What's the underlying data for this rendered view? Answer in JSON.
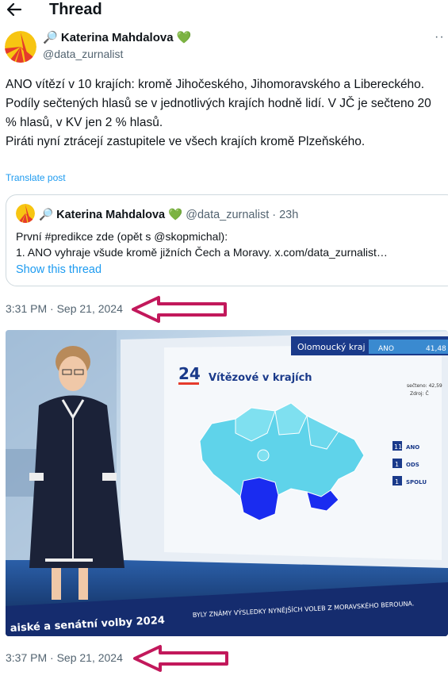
{
  "header": {
    "title": "Thread",
    "back_icon": "arrow-left-icon"
  },
  "post": {
    "author_emoji": "🔎",
    "author_name": "Katerina Mahdalova",
    "author_badge": "💚",
    "handle": "@data_zurnalist",
    "more_label": "··",
    "text": "ANO vítězí v 10 krajích: kromě Jihočeského, Jihomoravského a Libereckého.\nPodíly sečtených hlasů se v jednotlivých krajích hodně lidí. V JČ je sečteno 20 % hlasů, v KV jen 2 % hlasů.\nPiráti nyní ztrácejí zastupitele ve všech krajích kromě Plzeňského.",
    "translate_label": "Translate post",
    "timestamp_1": "3:31 PM · Sep 21, 2024",
    "timestamp_2": "3:37 PM · Sep 21, 2024"
  },
  "quote": {
    "author_emoji": "🔎",
    "author_name": "Katerina Mahdalova",
    "author_badge": "💚",
    "handle": "@data_zurnalist",
    "age": "· 23h",
    "text": "První #predikce zde (opět s @skopmichal):\n1. ANO vyhraje všude kromě jižních Čech a Moravy. x.com/data_zurnalist…",
    "show_thread_label": "Show this thread"
  },
  "tv": {
    "region_label": "Olomoucký kraj",
    "region_party": "ANO",
    "region_value": "41,48",
    "logo": "24",
    "map_title": "Vítězové v krajích",
    "counted_label": "sečteno: 42,59",
    "source_label": "Zdroj: Č",
    "legend": [
      {
        "count": "11",
        "party": "ANO",
        "color": "#7fe0f0"
      },
      {
        "count": "1",
        "party": "ODS",
        "color": "#1a3cf0"
      },
      {
        "count": "1",
        "party": "SPOLU",
        "color": "#1a3cf0"
      }
    ],
    "ticker_title": "aiské a senátní volby 2024",
    "ticker_text": "BYLY ZNÁMY VÝSLEDKY NYNĚJŠÍCH VOLEB Z MORAVSKÉHO BEROUNA."
  },
  "colors": {
    "accent": "#1d9bf0",
    "arrow": "#c2185b",
    "secondary_text": "#536471"
  }
}
